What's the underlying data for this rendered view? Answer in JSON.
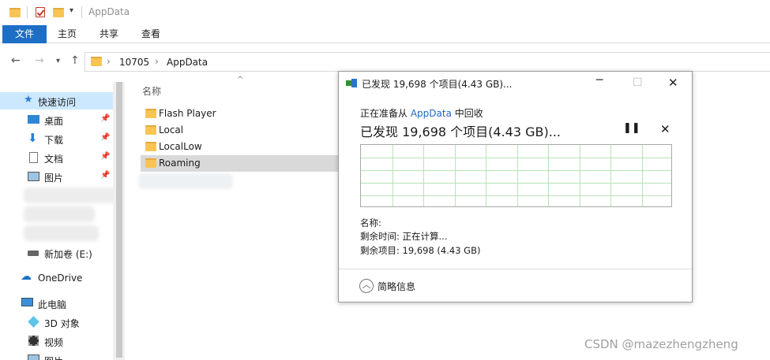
{
  "window": {
    "title": "AppData"
  },
  "ribbon": {
    "tabs": [
      "文件",
      "主页",
      "共享",
      "查看"
    ]
  },
  "address": {
    "crumbs": [
      "10705",
      "AppData"
    ]
  },
  "nav_pane": {
    "items": [
      {
        "label": "快速访问",
        "icon": "star-icon"
      },
      {
        "label": "桌面",
        "icon": "desktop-icon",
        "pinned": true
      },
      {
        "label": "下载",
        "icon": "download-icon",
        "pinned": true
      },
      {
        "label": "文档",
        "icon": "document-icon",
        "pinned": true
      },
      {
        "label": "图片",
        "icon": "pictures-icon",
        "pinned": true
      },
      {
        "label": "新加卷 (E:)",
        "icon": "drive-icon"
      },
      {
        "label": "OneDrive",
        "icon": "cloud-icon"
      },
      {
        "label": "此电脑",
        "icon": "computer-icon"
      },
      {
        "label": "3D 对象",
        "icon": "3d-objects-icon"
      },
      {
        "label": "视频",
        "icon": "video-icon"
      },
      {
        "label": "图片",
        "icon": "pictures-icon"
      }
    ]
  },
  "file_list": {
    "column_name": "名称",
    "rows": [
      "Flash Player",
      "Local",
      "LocalLow",
      "Roaming"
    ]
  },
  "dialog": {
    "title": "已发现 19,698 个项目(4.43 GB)...",
    "prep_prefix": "正在准备从",
    "prep_link": "AppData",
    "prep_suffix": "中回收",
    "big_status": "已发现 19,698 个项目(4.43 GB)...",
    "pause_glyph": "❚❚",
    "stop_glyph": "✕",
    "name_label": "名称:",
    "time_remaining": "剩余时间: 正在计算...",
    "items_remaining": "剩余项目: 19,698 (4.43 GB)",
    "more_details": "简略信息"
  },
  "colors": {
    "accent": "#1d6fc6",
    "grid": "#b7e3b7",
    "selection": "#d9d9d9"
  },
  "watermark": "CSDN @mazezhengzheng"
}
